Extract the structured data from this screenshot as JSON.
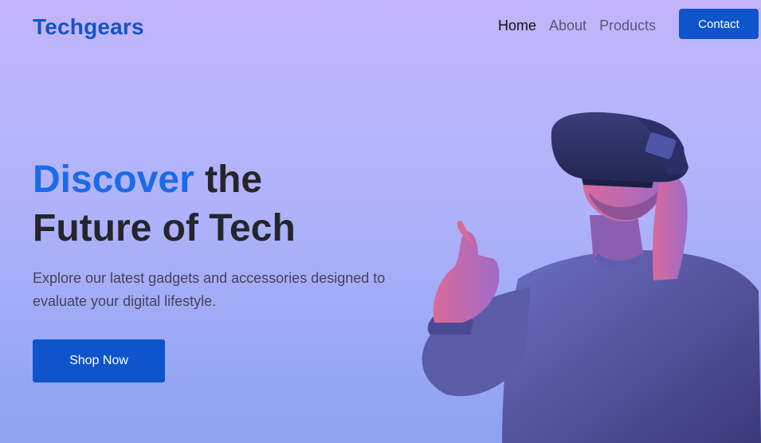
{
  "brand": {
    "name": "Techgears"
  },
  "nav": {
    "items": [
      {
        "label": "Home",
        "active": true
      },
      {
        "label": "About",
        "active": false
      },
      {
        "label": "Products",
        "active": false
      }
    ],
    "contact_label": "Contact"
  },
  "hero": {
    "title_accent": "Discover",
    "title_rest_line1": " the",
    "title_line2": "Future of Tech",
    "description": "Explore our latest gadgets and accessories designed to evaluate your digital lifestyle.",
    "cta_label": "Shop Now"
  },
  "colors": {
    "brand": "#1753c4",
    "accent": "#1c6ae8",
    "button": "#0e55cc",
    "background_top": "#c2b5fb",
    "background_bottom": "#8ea2f2"
  }
}
